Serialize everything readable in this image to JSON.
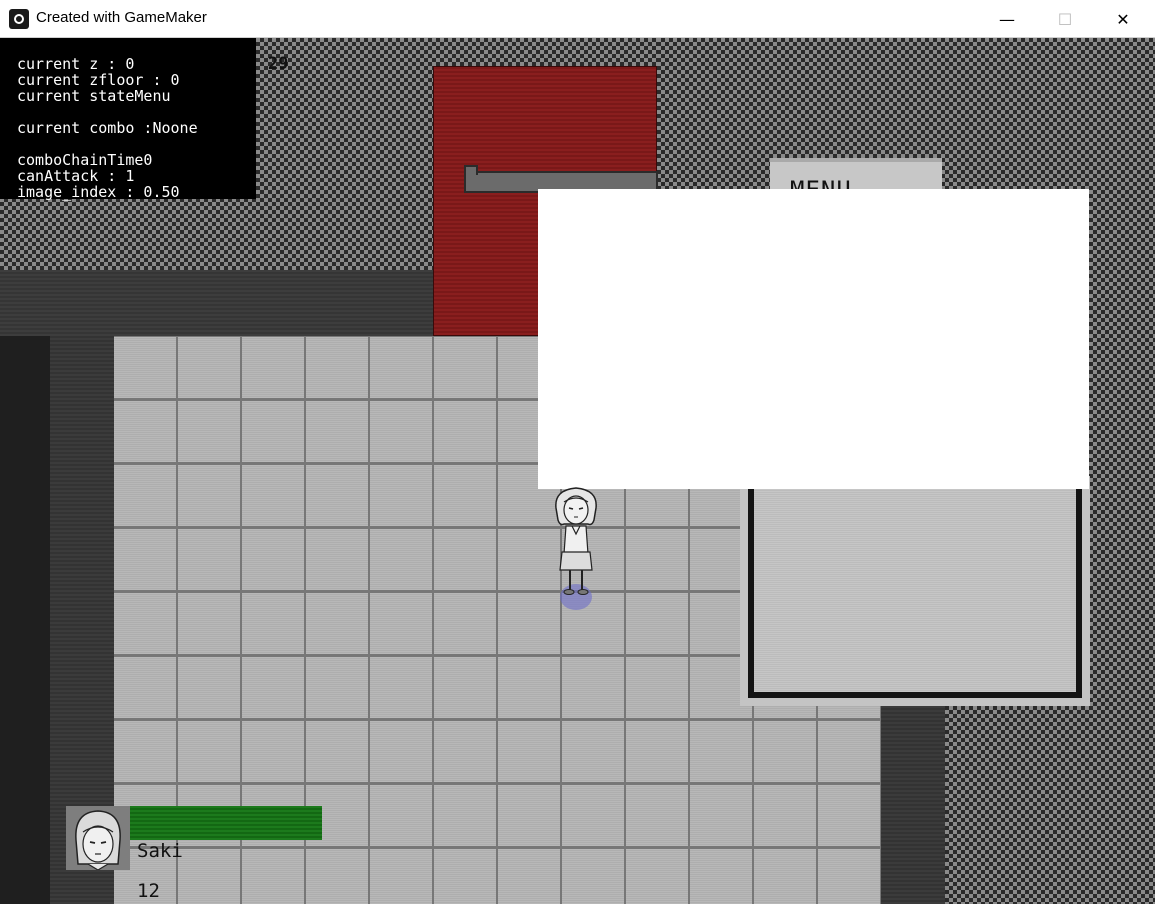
{
  "window": {
    "title": "Created with GameMaker",
    "minimize_glyph": "—",
    "maximize_glyph": "☐",
    "close_glyph": "✕"
  },
  "debug": {
    "lines": [
      "current z : 0",
      "current zfloor : 0",
      "current stateMenu",
      "",
      "current combo :Noone",
      "",
      "comboChainTime0",
      "canAttack : 1",
      "image_index : 0.50"
    ]
  },
  "fps": "29",
  "menu": {
    "label": "MENU"
  },
  "player": {
    "name": "Saki",
    "hp_value": "12",
    "hp_fraction": 1.0
  },
  "colors": {
    "hp_bar": "#1c7a1c",
    "door": "#8a1e1e",
    "shadow": "#6e6ec8"
  }
}
